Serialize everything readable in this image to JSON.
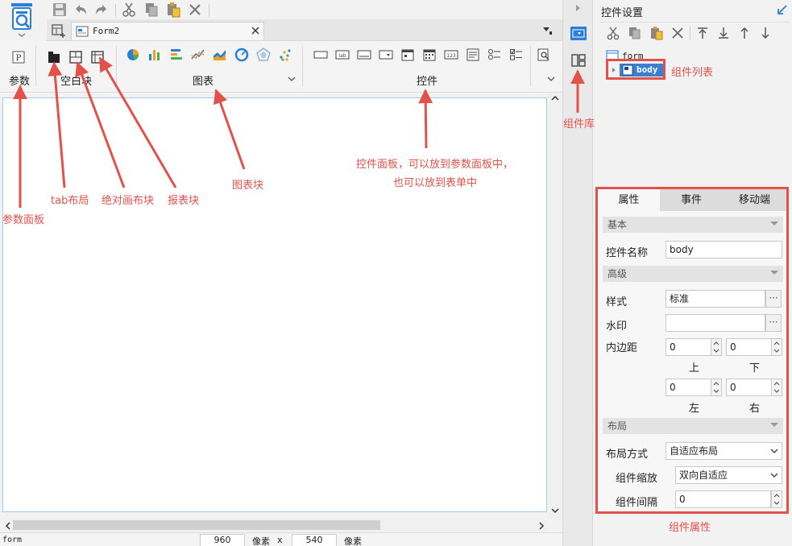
{
  "tabs": {
    "active_label": "Form2"
  },
  "ribbon": {
    "groups": {
      "params": "参数",
      "blank": "空白块",
      "chart": "图表",
      "widget": "控件"
    }
  },
  "statusbar": {
    "left": "form",
    "width": "960",
    "unit1": "像素",
    "x": "x",
    "height": "540",
    "unit2": "像素"
  },
  "right_panel": {
    "title": "控件设置",
    "tree": {
      "root": "form",
      "child": "body"
    },
    "props": {
      "tabs": [
        "属性",
        "事件",
        "移动端"
      ],
      "sections": {
        "basic": "基本",
        "advanced": "高级",
        "layout": "布局"
      },
      "fields": {
        "name_label": "控件名称",
        "name_value": "body",
        "style_label": "样式",
        "style_value": "标准",
        "watermark_label": "水印",
        "watermark_value": "",
        "padding_label": "内边距",
        "top_value": "0",
        "bottom_value": "0",
        "left_value": "0",
        "right_value": "0",
        "top_label": "上",
        "bottom_label": "下",
        "left_label": "左",
        "right_label": "右",
        "layout_mode_label": "布局方式",
        "layout_mode_value": "自适应布局",
        "scale_label": "组件缩放",
        "scale_value": "双向自适应",
        "gap_label": "组件间隔",
        "gap_value": "0"
      }
    }
  },
  "annotations": {
    "params_panel": "参数面板",
    "tab_layout": "tab布局",
    "absolute_canvas": "绝对画布块",
    "report_block": "报表块",
    "chart_block": "图表块",
    "widget_panel_line1": "控件面板，可以放到参数面板中，",
    "widget_panel_line2": "也可以放到表单中",
    "component_lib": "组件库",
    "component_list": "组件列表",
    "component_props": "组件属性"
  },
  "colors": {
    "annotation": "#e2524b",
    "accent": "#2a7fd4",
    "selection": "#3a7fd0"
  }
}
